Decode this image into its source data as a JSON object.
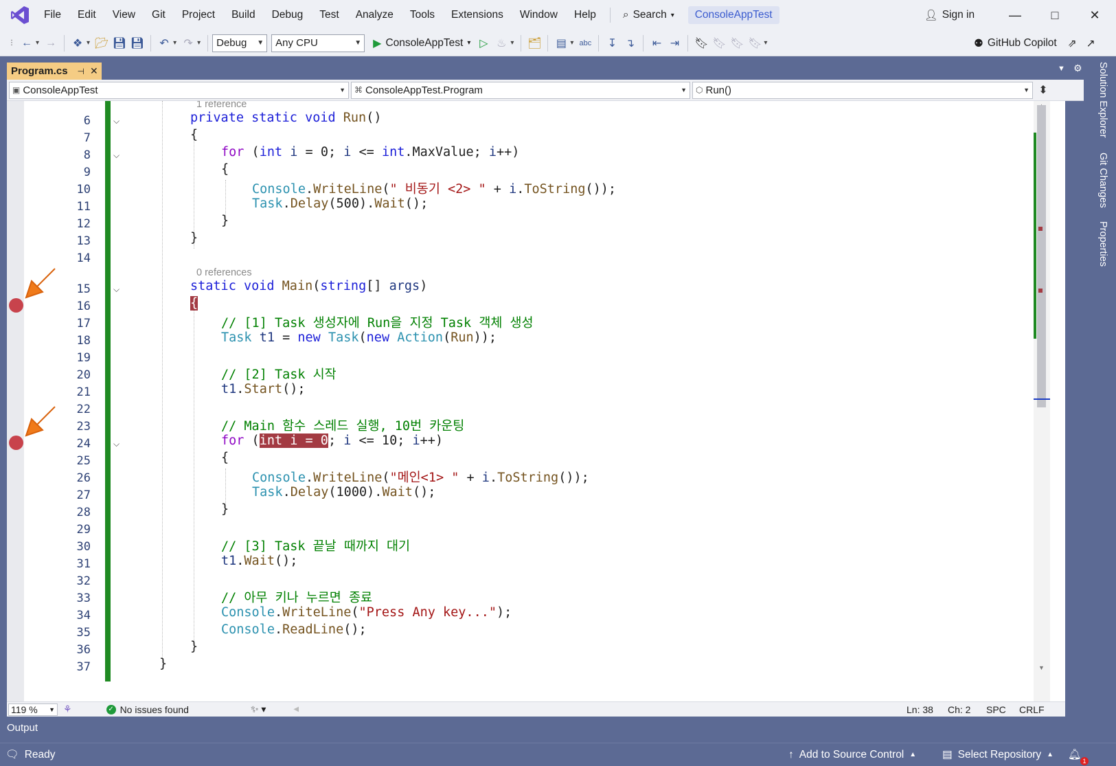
{
  "menu": {
    "items": [
      "File",
      "Edit",
      "View",
      "Git",
      "Project",
      "Build",
      "Debug",
      "Test",
      "Analyze",
      "Tools",
      "Extensions",
      "Window",
      "Help"
    ],
    "search_label": "Search",
    "solution_name": "ConsoleAppTest",
    "sign_in": "Sign in"
  },
  "toolbar": {
    "configuration": "Debug",
    "platform": "Any CPU",
    "run_target": "ConsoleAppTest",
    "copilot": "GitHub Copilot"
  },
  "tab": {
    "file_name": "Program.cs"
  },
  "navbar": {
    "project": "ConsoleAppTest",
    "class": "ConsoleAppTest.Program",
    "member": "Run()"
  },
  "editor": {
    "lens_run": "1 reference",
    "lens_main": "0 references",
    "line_numbers": [
      "6",
      "7",
      "8",
      "9",
      "10",
      "11",
      "12",
      "13",
      "14",
      "15",
      "16",
      "17",
      "18",
      "19",
      "20",
      "21",
      "22",
      "23",
      "24",
      "25",
      "26",
      "27",
      "28",
      "29",
      "30",
      "31",
      "32",
      "33",
      "34",
      "35",
      "36",
      "37"
    ],
    "breakpoint_lines": [
      16,
      24
    ]
  },
  "editor_status": {
    "zoom": "119 %",
    "issues": "No issues found",
    "line": "Ln: 38",
    "column": "Ch: 2",
    "whitespace": "SPC",
    "line_ending": "CRLF"
  },
  "side_tabs": [
    "Solution Explorer",
    "Git Changes",
    "Properties"
  ],
  "output_label": "Output",
  "statusbar": {
    "ready": "Ready",
    "source_control": "Add to Source Control",
    "repository": "Select Repository",
    "notifications": "1"
  },
  "colors": {
    "accent": "#5c6a94",
    "breakpoint": "#c8434c",
    "change_bar": "#1f8a22",
    "tab_active": "#f5cc84"
  }
}
